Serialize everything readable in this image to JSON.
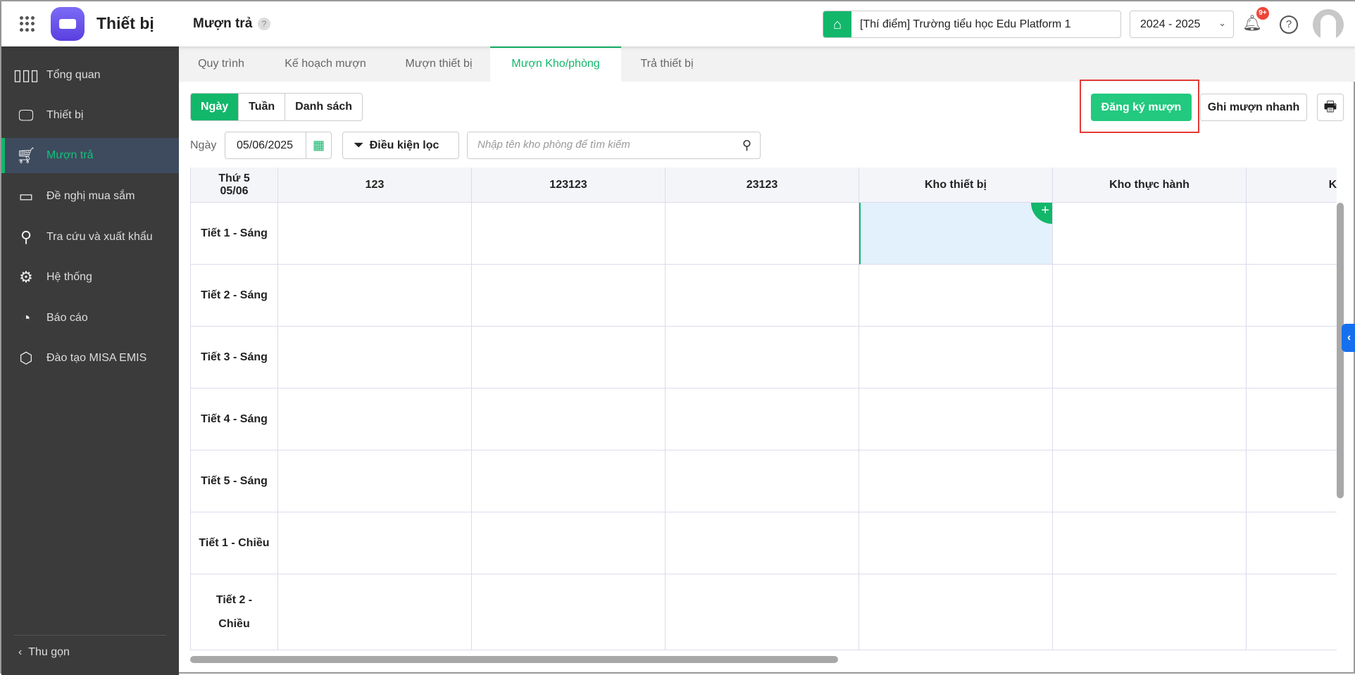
{
  "header": {
    "app_name": "Thiết bị",
    "page_title": "Mượn trả",
    "help_mark": "?",
    "school": "[Thí điểm] Trường tiểu học Edu Platform 1",
    "year": "2024 - 2025",
    "notification_badge": "9+",
    "help_icon": "?"
  },
  "sidebar": {
    "items": [
      {
        "label": "Tổng quan",
        "icon": "bar-chart-icon"
      },
      {
        "label": "Thiết bị",
        "icon": "monitor-icon"
      },
      {
        "label": "Mượn trả",
        "icon": "cart-icon",
        "active": true
      },
      {
        "label": "Đề nghị mua sắm",
        "icon": "projector-icon"
      },
      {
        "label": "Tra cứu và xuất khẩu",
        "icon": "search-icon"
      },
      {
        "label": "Hệ thống",
        "icon": "gear-icon"
      },
      {
        "label": "Báo cáo",
        "icon": "pie-chart-icon"
      },
      {
        "label": "Đào tạo MISA EMIS",
        "icon": "cube-icon"
      }
    ],
    "collapse_label": "Thu gọn"
  },
  "tabs": [
    {
      "label": "Quy trình"
    },
    {
      "label": "Kế hoạch mượn"
    },
    {
      "label": "Mượn thiết bị"
    },
    {
      "label": "Mượn Kho/phòng",
      "active": true
    },
    {
      "label": "Trả thiết bị"
    }
  ],
  "view_modes": [
    "Ngày",
    "Tuần",
    "Danh sách"
  ],
  "actions": {
    "register": "Đăng ký mượn",
    "quick": "Ghi mượn nhanh"
  },
  "filters": {
    "date_label": "Ngày",
    "date_value": "05/06/2025",
    "filter_button": "Điều kiện lọc",
    "search_placeholder": "Nhập tên kho phòng để tìm kiếm"
  },
  "grid": {
    "corner": "Thứ 5\n05/06",
    "columns": [
      "123",
      "123123",
      "23123",
      "Kho thiết bị",
      "Kho thực hành",
      "Kho t"
    ],
    "rows": [
      "Tiết 1 - Sáng",
      "Tiết 2 - Sáng",
      "Tiết 3 - Sáng",
      "Tiết 4 - Sáng",
      "Tiết 5 - Sáng",
      "Tiết 1 - Chiều",
      "Tiết 2 -\nChiều"
    ],
    "selected": {
      "row": 0,
      "col": 3
    },
    "add_symbol": "+"
  },
  "colors": {
    "accent": "#12b76a",
    "sidebar": "#3b3b3b",
    "highlight": "#e53935"
  }
}
